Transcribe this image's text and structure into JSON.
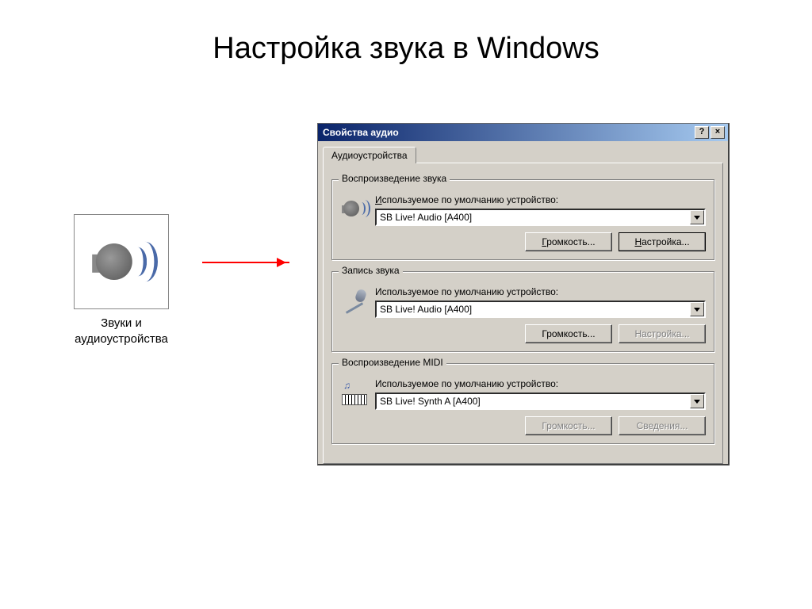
{
  "slide_title": "Настройка звука в Windows",
  "desktop_icon_label": "Звуки и аудиоустройства",
  "window": {
    "title": "Свойства аудио",
    "help_btn": "?",
    "close_btn": "×",
    "tab": "Аудиоустройства",
    "groups": {
      "playback": {
        "title": "Воспроизведение звука",
        "label_pre": "И",
        "label_rest": "спользуемое по умолчанию устройство:",
        "device": "SB Live! Audio [A400]",
        "volume_btn_pre": "Г",
        "volume_btn_rest": "ромкость...",
        "settings_btn_pre": "Н",
        "settings_btn_rest": "астройка..."
      },
      "recording": {
        "title": "Запись звука",
        "label": "Используемое по умолчанию устройство:",
        "device": "SB Live! Audio [A400]",
        "volume_btn": "Громкость...",
        "settings_btn": "Настройка..."
      },
      "midi": {
        "title": "Воспроизведение MIDI",
        "label": "Используемое по умолчанию устройство:",
        "device": "SB Live! Synth A [A400]",
        "volume_btn": "Громкость...",
        "info_btn": "Сведения..."
      }
    }
  }
}
